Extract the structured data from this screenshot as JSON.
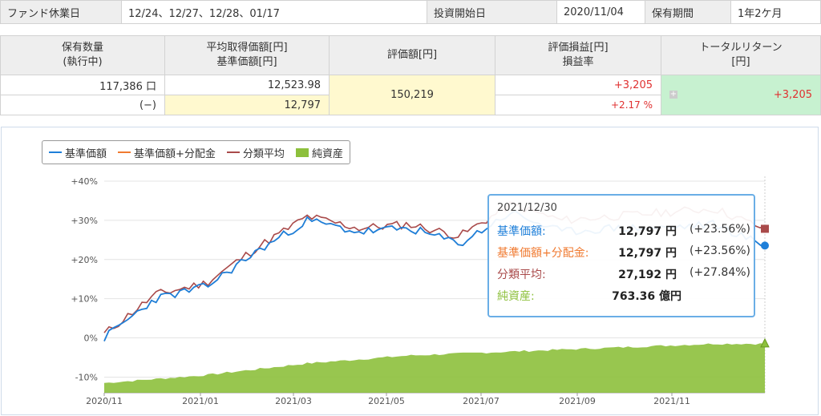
{
  "info": {
    "holiday_label": "ファンド休業日",
    "holiday_value": "12/24、12/27、12/28、01/17",
    "start_label": "投資開始日",
    "start_value": "2020/11/04",
    "period_label": "保有期間",
    "period_value": "1年2ケ月"
  },
  "summary": {
    "h_qty": "保有数量\n(執行中)",
    "h_avg": "平均取得価額[円]\n基準価額[円]",
    "h_eval": "評価額[円]",
    "h_pl": "評価損益[円]\n損益率",
    "h_total": "トータルリターン\n[円]",
    "qty": "117,386 口",
    "pending": "(−)",
    "avg_cost": "12,523.98",
    "nav": "12,797",
    "eval": "150,219",
    "pl": "+3,205",
    "pl_rate": "+2.17 %",
    "total_return": "+3,205"
  },
  "legend": {
    "nav": "基準価額",
    "nav_div": "基準価額+分配金",
    "category": "分類平均",
    "assets": "純資産"
  },
  "colors": {
    "nav": "#1e7fd9",
    "nav_div": "#f07a30",
    "category": "#a94a4a",
    "assets": "#8dc03c",
    "tooltip_border": "#6aaee6",
    "profit": "#e03030"
  },
  "tooltip": {
    "date": "2021/12/30",
    "nav_label": "基準価額:",
    "nav_value": "12,797 円",
    "nav_pct": "(+23.56%)",
    "navdiv_label": "基準価額+分配金:",
    "navdiv_value": "12,797 円",
    "navdiv_pct": "(+23.56%)",
    "cat_label": "分類平均:",
    "cat_value": "27,192 円",
    "cat_pct": "(+27.84%)",
    "assets_label": "純資産:",
    "assets_value": "763.36 億円"
  },
  "chart_data": {
    "type": "line",
    "y_ticks": [
      "+40%",
      "+30%",
      "+20%",
      "+10%",
      "0%",
      "-10%"
    ],
    "x_ticks": [
      "2020/11",
      "2021/01",
      "2021/03",
      "2021/05",
      "2021/07",
      "2021/09",
      "2021/11"
    ],
    "ylim": [
      -14,
      40
    ],
    "x_months": [
      "2020/11",
      "2020/12",
      "2021/01",
      "2021/02",
      "2021/03",
      "2021/04",
      "2021/05",
      "2021/06",
      "2021/07",
      "2021/08",
      "2021/09",
      "2021/10",
      "2021/11",
      "2021/12"
    ],
    "series": [
      {
        "name": "基準価額",
        "values": [
          0,
          10,
          13,
          22,
          30,
          27,
          28,
          24,
          32,
          27,
          28,
          28,
          29,
          23.56
        ]
      },
      {
        "name": "基準価額+分配金",
        "values": [
          0,
          10,
          13,
          22,
          30,
          27,
          28,
          24,
          32,
          27,
          28,
          28,
          29,
          23.56
        ]
      },
      {
        "name": "分類平均",
        "values": [
          1,
          11,
          14,
          23,
          31,
          28,
          29,
          26,
          34,
          30,
          31,
          32,
          33,
          27.84
        ]
      },
      {
        "name": "純資産",
        "values": [
          -11.5,
          -10.5,
          -9.5,
          -8,
          -6.5,
          -5.5,
          -4.5,
          -4,
          -3.5,
          -3,
          -2.5,
          -2,
          -1.5,
          -1.5
        ]
      }
    ]
  }
}
